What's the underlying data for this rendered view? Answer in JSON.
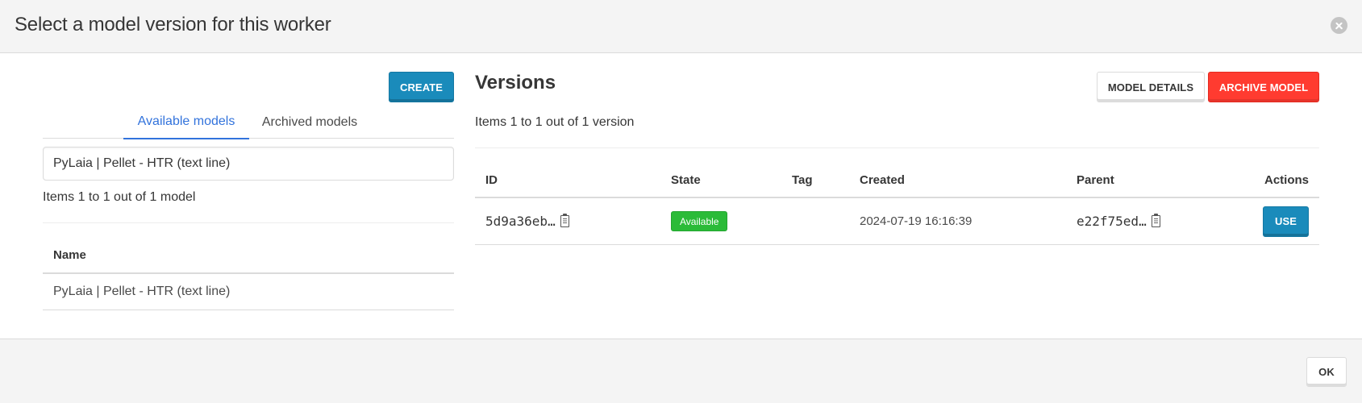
{
  "modal": {
    "title": "Select a model version for this worker",
    "close_icon": "close-circle-icon",
    "footer": {
      "ok_label": "OK"
    }
  },
  "left": {
    "create_label": "CREATE",
    "tabs": [
      {
        "label": "Available models",
        "active": true
      },
      {
        "label": "Archived models",
        "active": false
      }
    ],
    "search": {
      "value": "PyLaia | Pellet - HTR (text line)",
      "placeholder": ""
    },
    "count_text": "Items 1 to 1 out of 1 model",
    "table": {
      "headers": [
        "Name"
      ],
      "rows": [
        {
          "name": "PyLaia | Pellet - HTR (text line)"
        }
      ]
    }
  },
  "right": {
    "title": "Versions",
    "model_details_label": "MODEL DETAILS",
    "archive_model_label": "ARCHIVE MODEL",
    "count_text": "Items 1 to 1 out of 1 version",
    "table": {
      "headers": {
        "id": "ID",
        "state": "State",
        "tag": "Tag",
        "created": "Created",
        "parent": "Parent",
        "actions": "Actions"
      },
      "rows": [
        {
          "id": "5d9a36eb…",
          "id_copy_icon": "clipboard-icon",
          "state": "Available",
          "tag": "",
          "created": "2024-07-19 16:16:39",
          "parent": "e22f75ed…",
          "parent_copy_icon": "clipboard-icon",
          "action_label": "USE"
        }
      ]
    }
  },
  "colors": {
    "primary": "#1a8bbb",
    "danger": "#ff3b30",
    "link": "#3273dc",
    "success": "#2bbb38",
    "header_bg": "#f4f4f4"
  }
}
